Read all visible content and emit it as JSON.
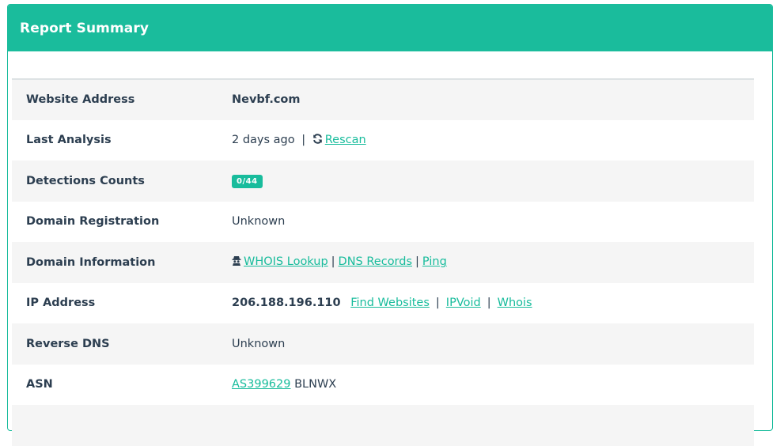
{
  "panel": {
    "title": "Report Summary",
    "accent_color": "#1abc9c"
  },
  "rows": {
    "website_address": {
      "label": "Website Address",
      "value": "Nevbf.com"
    },
    "last_analysis": {
      "label": "Last Analysis",
      "value": "2 days ago",
      "separator": "|",
      "rescan_icon": "refresh-icon",
      "rescan_label": "Rescan"
    },
    "detections": {
      "label": "Detections Counts",
      "badge": "0/44"
    },
    "domain_registration": {
      "label": "Domain Registration",
      "value": "Unknown"
    },
    "domain_information": {
      "label": "Domain Information",
      "icon": "spy-icon",
      "whois": "WHOIS Lookup",
      "dns": "DNS Records",
      "ping": "Ping",
      "separator": "|"
    },
    "ip_address": {
      "label": "IP Address",
      "value": "206.188.196.110",
      "find_websites": "Find Websites",
      "ipvoid": "IPVoid",
      "whois": "Whois",
      "separator": "|"
    },
    "reverse_dns": {
      "label": "Reverse DNS",
      "value": "Unknown"
    },
    "asn": {
      "label": "ASN",
      "link": "AS399629",
      "value": "BLNWX"
    }
  }
}
